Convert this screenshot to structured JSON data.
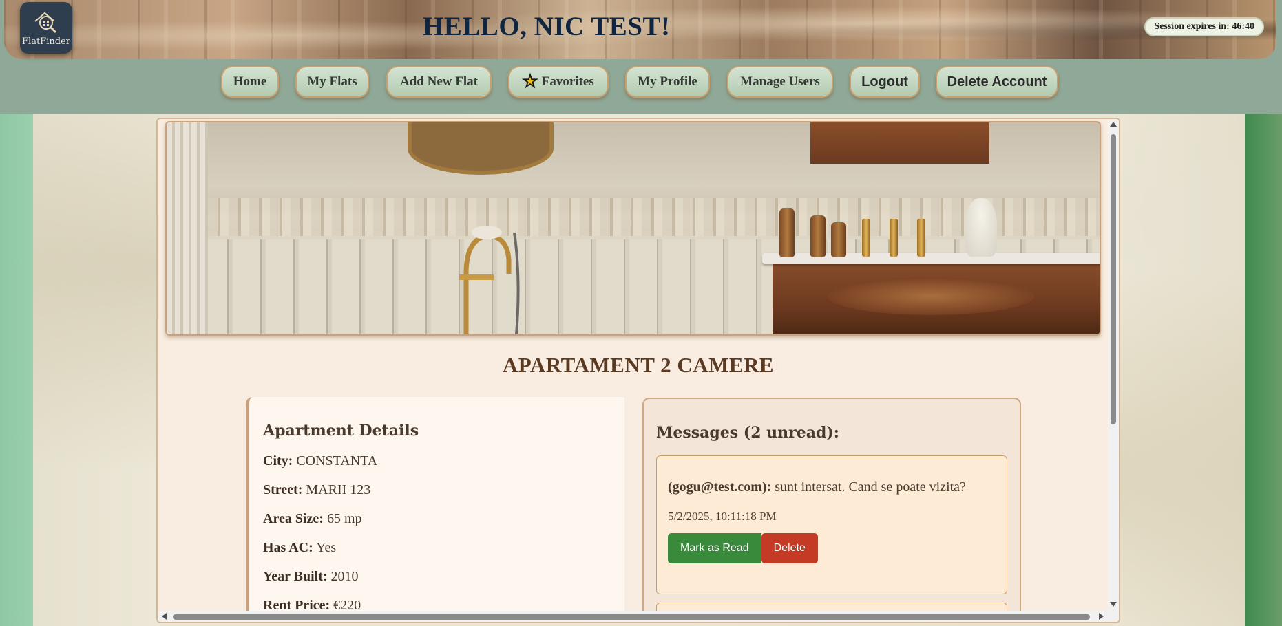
{
  "header": {
    "logo_text": "FlatFinder",
    "greeting": "HELLO, NIC TEST!",
    "session_text": "Session expires in: 46:40"
  },
  "nav": {
    "items": [
      {
        "label": "Home",
        "icon": ""
      },
      {
        "label": "My Flats",
        "icon": ""
      },
      {
        "label": "Add New Flat",
        "icon": ""
      },
      {
        "label": "Favorites",
        "icon": "star-icon"
      },
      {
        "label": "My Profile",
        "icon": ""
      },
      {
        "label": "Manage Users",
        "icon": ""
      },
      {
        "label": "Logout",
        "icon": ""
      },
      {
        "label": "Delete Account",
        "icon": ""
      }
    ]
  },
  "flat": {
    "title": "APARTAMENT 2 CAMERE",
    "details_heading": "Apartment Details",
    "details": [
      {
        "label": "City:",
        "value": "CONSTANTA"
      },
      {
        "label": "Street:",
        "value": "MARII 123"
      },
      {
        "label": "Area Size:",
        "value": "65 mp"
      },
      {
        "label": "Has AC:",
        "value": "Yes"
      },
      {
        "label": "Year Built:",
        "value": "2010"
      },
      {
        "label": "Rent Price:",
        "value": "€220"
      }
    ]
  },
  "messages": {
    "heading": "Messages (2 unread):",
    "items": [
      {
        "sender": "(gogu@test.com):",
        "text": "sunt intersat. Cand se poate vizita?",
        "date": "5/2/2025, 10:11:18 PM",
        "mark_read_label": "Mark as Read",
        "delete_label": "Delete"
      }
    ]
  },
  "colors": {
    "accent_green": "#3a8a3c",
    "danger_red": "#c53a25",
    "title_brown": "#5a3a22",
    "greeting_navy": "#0f2540"
  }
}
